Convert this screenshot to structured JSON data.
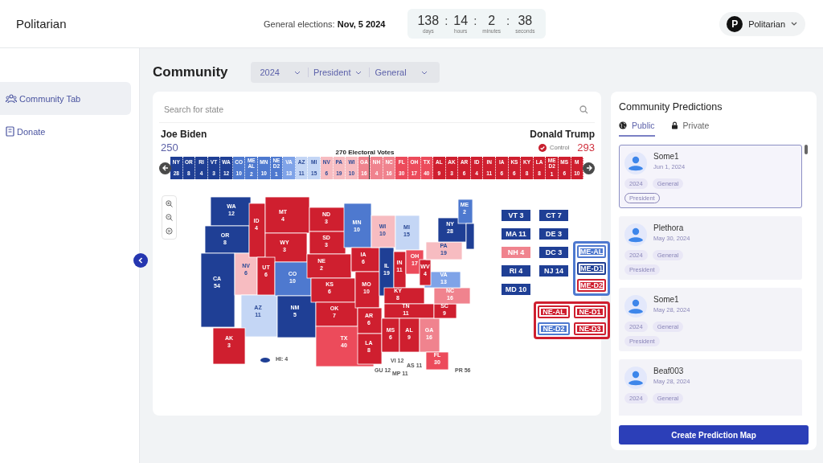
{
  "header": {
    "brand": "Politarian",
    "election": "General elections: **Nov, 5 2024**",
    "countdown": {
      "separator": ":",
      "units": [
        {
          "value": "138",
          "unit": "days"
        },
        {
          "value": "14",
          "unit": "hours"
        },
        {
          "value": "2",
          "unit": "minutes"
        },
        {
          "value": "38",
          "unit": "seconds"
        }
      ]
    },
    "user": {
      "initial": "P",
      "name": "Politarian"
    }
  },
  "sidebar": {
    "items": [
      {
        "label": "Community Tab",
        "selected": true
      },
      {
        "label": "Donate",
        "selected": false
      }
    ]
  },
  "page": {
    "title": "Community",
    "filters": [
      "2024",
      "President",
      "General"
    ]
  },
  "map_card": {
    "search": {
      "placeholder": "Search for state"
    },
    "candidates": [
      {
        "name": "Joe Biden",
        "votes": "250",
        "color": "#5b60a6"
      },
      {
        "name": "Donald Trump",
        "votes": "293",
        "color": "#d0313e",
        "control": "Control"
      }
    ],
    "threshold": "270 Electoral Votes",
    "segments": [
      {
        "abbr": "NY",
        "votes": "28",
        "color": "#1f3f95"
      },
      {
        "abbr": "OR",
        "votes": "8",
        "color": "#1f3f95"
      },
      {
        "abbr": "RI",
        "votes": "4",
        "color": "#1f3f95"
      },
      {
        "abbr": "VT",
        "votes": "3",
        "color": "#1f3f95"
      },
      {
        "abbr": "WA",
        "votes": "12",
        "color": "#1f3f95"
      },
      {
        "abbr": "CO",
        "votes": "10",
        "color": "#4e79cf"
      },
      {
        "abbr": "ME AL",
        "votes": "2",
        "color": "#4e79cf"
      },
      {
        "abbr": "MN",
        "votes": "10",
        "color": "#4e79cf"
      },
      {
        "abbr": "NE D2",
        "votes": "1",
        "color": "#4e79cf"
      },
      {
        "abbr": "VA",
        "votes": "13",
        "color": "#7fa3e8"
      },
      {
        "abbr": "AZ",
        "votes": "11",
        "color": "#c4d6f5"
      },
      {
        "abbr": "MI",
        "votes": "15",
        "color": "#c4d6f5"
      },
      {
        "abbr": "NV",
        "votes": "6",
        "color": "#f7bcc1"
      },
      {
        "abbr": "PA",
        "votes": "19",
        "color": "#f7bcc1"
      },
      {
        "abbr": "WI",
        "votes": "10",
        "color": "#f7bcc1"
      },
      {
        "abbr": "GA",
        "votes": "16",
        "color": "#f0838e"
      },
      {
        "abbr": "NH",
        "votes": "4",
        "color": "#f0838e"
      },
      {
        "abbr": "NC",
        "votes": "16",
        "color": "#f0838e"
      },
      {
        "abbr": "FL",
        "votes": "30",
        "color": "#ec4b5b"
      },
      {
        "abbr": "OH",
        "votes": "17",
        "color": "#ec4b5b"
      },
      {
        "abbr": "TX",
        "votes": "40",
        "color": "#ec4b5b"
      },
      {
        "abbr": "AL",
        "votes": "9",
        "color": "#cf1f2f"
      },
      {
        "abbr": "AK",
        "votes": "3",
        "color": "#cf1f2f"
      },
      {
        "abbr": "AR",
        "votes": "6",
        "color": "#cf1f2f"
      },
      {
        "abbr": "ID",
        "votes": "4",
        "color": "#cf1f2f"
      },
      {
        "abbr": "IN",
        "votes": "11",
        "color": "#cf1f2f"
      },
      {
        "abbr": "IA",
        "votes": "6",
        "color": "#cf1f2f"
      },
      {
        "abbr": "KS",
        "votes": "6",
        "color": "#cf1f2f"
      },
      {
        "abbr": "KY",
        "votes": "8",
        "color": "#cf1f2f"
      },
      {
        "abbr": "LA",
        "votes": "8",
        "color": "#cf1f2f"
      },
      {
        "abbr": "ME D2",
        "votes": "1",
        "color": "#cf1f2f"
      },
      {
        "abbr": "MS",
        "votes": "6",
        "color": "#cf1f2f"
      },
      {
        "abbr": "M",
        "votes": "10",
        "color": "#cf1f2f"
      }
    ],
    "states": [
      {
        "abbr": "WA",
        "votes": "12",
        "color": "#1f3f95"
      },
      {
        "abbr": "OR",
        "votes": "8",
        "color": "#1f3f95"
      },
      {
        "abbr": "CA",
        "votes": "54",
        "color": "#1f3f95"
      },
      {
        "abbr": "NV",
        "votes": "6",
        "color": "#f7bcc1"
      },
      {
        "abbr": "ID",
        "votes": "4",
        "color": "#cf1f2f"
      },
      {
        "abbr": "MT",
        "votes": "4",
        "color": "#cf1f2f"
      },
      {
        "abbr": "WY",
        "votes": "3",
        "color": "#cf1f2f"
      },
      {
        "abbr": "UT",
        "votes": "6",
        "color": "#cf1f2f"
      },
      {
        "abbr": "AZ",
        "votes": "11",
        "color": "#c4d6f5"
      },
      {
        "abbr": "CO",
        "votes": "10",
        "color": "#4e79cf"
      },
      {
        "abbr": "NM",
        "votes": "5",
        "color": "#1f3f95"
      },
      {
        "abbr": "ND",
        "votes": "3",
        "color": "#cf1f2f"
      },
      {
        "abbr": "SD",
        "votes": "3",
        "color": "#cf1f2f"
      },
      {
        "abbr": "NE",
        "votes": "2",
        "color": "#cf1f2f"
      },
      {
        "abbr": "KS",
        "votes": "6",
        "color": "#cf1f2f"
      },
      {
        "abbr": "OK",
        "votes": "7",
        "color": "#cf1f2f"
      },
      {
        "abbr": "TX",
        "votes": "40",
        "color": "#ec4b5b"
      },
      {
        "abbr": "MN",
        "votes": "10",
        "color": "#4e79cf"
      },
      {
        "abbr": "IA",
        "votes": "6",
        "color": "#cf1f2f"
      },
      {
        "abbr": "MO",
        "votes": "10",
        "color": "#cf1f2f"
      },
      {
        "abbr": "AR",
        "votes": "6",
        "color": "#cf1f2f"
      },
      {
        "abbr": "LA",
        "votes": "8",
        "color": "#cf1f2f"
      },
      {
        "abbr": "WI",
        "votes": "10",
        "color": "#f7bcc1"
      },
      {
        "abbr": "IL",
        "votes": "19",
        "color": "#1f3f95"
      },
      {
        "abbr": "MI",
        "votes": "15",
        "color": "#c4d6f5"
      },
      {
        "abbr": "IN",
        "votes": "11",
        "color": "#cf1f2f"
      },
      {
        "abbr": "OH",
        "votes": "17",
        "color": "#ec4b5b"
      },
      {
        "abbr": "KY",
        "votes": "8",
        "color": "#cf1f2f"
      },
      {
        "abbr": "TN",
        "votes": "11",
        "color": "#cf1f2f"
      },
      {
        "abbr": "MS",
        "votes": "6",
        "color": "#cf1f2f"
      },
      {
        "abbr": "AL",
        "votes": "9",
        "color": "#cf1f2f"
      },
      {
        "abbr": "GA",
        "votes": "16",
        "color": "#f0838e"
      },
      {
        "abbr": "SC",
        "votes": "9",
        "color": "#cf1f2f"
      },
      {
        "abbr": "NC",
        "votes": "16",
        "color": "#f0838e"
      },
      {
        "abbr": "VA",
        "votes": "13",
        "color": "#7fa3e8"
      },
      {
        "abbr": "WV",
        "votes": "4",
        "color": "#cf1f2f"
      },
      {
        "abbr": "PA",
        "votes": "19",
        "color": "#f7bcc1"
      },
      {
        "abbr": "NY",
        "votes": "28",
        "color": "#1f3f95"
      },
      {
        "abbr": "ME",
        "votes": "2",
        "color": "#4e79cf"
      },
      {
        "abbr": "FL",
        "votes": "30",
        "color": "#ec4b5b"
      },
      {
        "abbr": "AK",
        "votes": "3",
        "color": "#cf1f2f"
      }
    ],
    "territories": [
      "HI: 4",
      "GU 12",
      "MP 11",
      "VI 12",
      "AS 11",
      "PR 56"
    ],
    "small_states": [
      {
        "label": "VT 3",
        "color": "#1f3f95"
      },
      {
        "label": "CT 7",
        "color": "#1f3f95"
      },
      {
        "label": "MA 11",
        "color": "#1f3f95"
      },
      {
        "label": "DE 3",
        "color": "#1f3f95"
      },
      {
        "label": "NH 4",
        "color": "#f0838e"
      },
      {
        "label": "DC 3",
        "color": "#1f3f95"
      },
      {
        "label": "RI 4",
        "color": "#1f3f95"
      },
      {
        "label": "NJ 14",
        "color": "#1f3f95"
      },
      {
        "label": "MD 10",
        "color": "#1f3f95"
      }
    ],
    "me_districts": {
      "color": "#4e79cf",
      "items": [
        {
          "label": "ME-AL",
          "color": "#4e79cf"
        },
        {
          "label": "ME-D1",
          "color": "#1f3f95"
        },
        {
          "label": "ME-D2",
          "color": "#cf1f2f"
        }
      ]
    },
    "ne_districts": {
      "color": "#cf1f2f",
      "items": [
        {
          "label": "NE-AL",
          "color": "#cf1f2f"
        },
        {
          "label": "NE-D1",
          "color": "#cf1f2f"
        },
        {
          "label": "NE-D2",
          "color": "#4e79cf"
        },
        {
          "label": "NE-D3",
          "color": "#cf1f2f"
        }
      ]
    }
  },
  "predictions": {
    "title": "Community Predictions",
    "tabs": [
      {
        "label": "Public",
        "selected": true
      },
      {
        "label": "Private",
        "selected": false
      }
    ],
    "cards": [
      {
        "name": "Some1",
        "date": "Jun 1, 2024",
        "tags": [
          "2024",
          "General",
          "President"
        ],
        "selected": true
      },
      {
        "name": "Plethora",
        "date": "May 30, 2024",
        "tags": [
          "2024",
          "General",
          "President"
        ],
        "selected": false
      },
      {
        "name": "Some1",
        "date": "May 28, 2024",
        "tags": [
          "2024",
          "General",
          "President"
        ],
        "selected": false
      },
      {
        "name": "Beaf003",
        "date": "May 28, 2024",
        "tags": [
          "2024",
          "General"
        ],
        "selected": false
      }
    ],
    "button": "Create Prediction Map"
  }
}
